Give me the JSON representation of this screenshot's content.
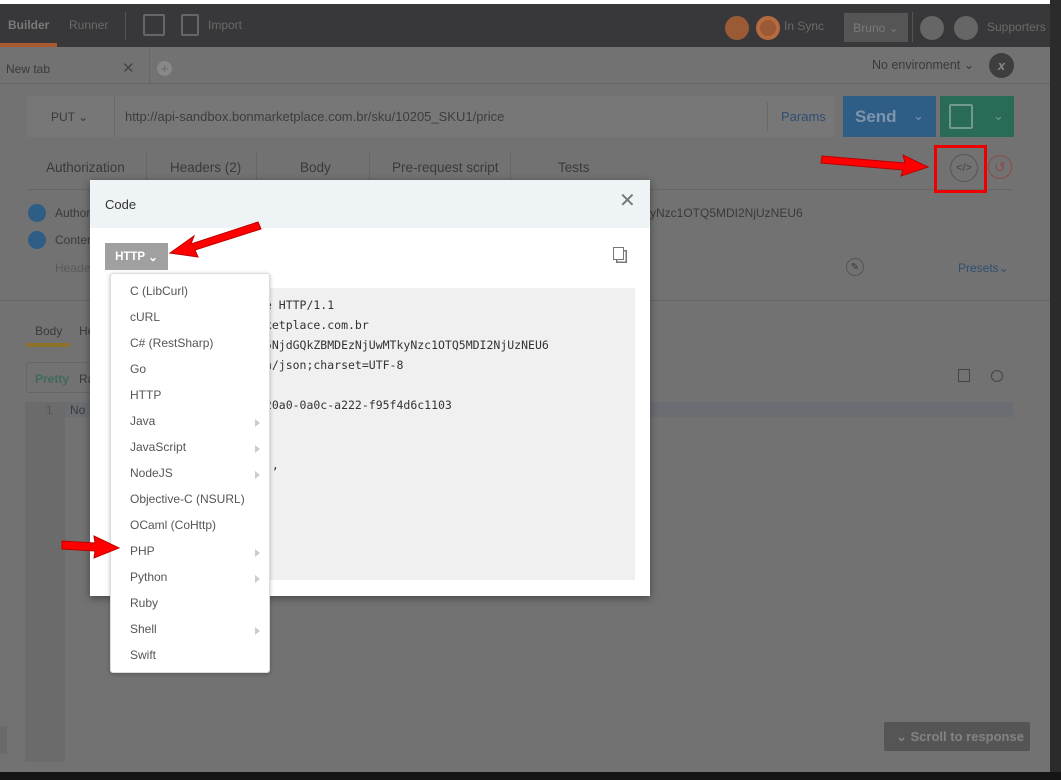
{
  "topbar": {
    "builder": "Builder",
    "runner": "Runner",
    "import": "Import",
    "sync": "In Sync",
    "user": "Bruno",
    "supporters": "Supporters"
  },
  "tabs": {
    "active": "New tab",
    "environment": "No environment"
  },
  "request": {
    "method": "PUT",
    "url": "http://api-sandbox.bonmarketplace.com.br/sku/10205_SKU1/price",
    "params": "Params",
    "send": "Send"
  },
  "request_tabs": [
    "Authorization",
    "Headers (2)",
    "Body",
    "Pre-request script",
    "Tests"
  ],
  "headers": {
    "row1_key": "Author",
    "row1_value": "yNzc1OTQ5MDI2NjUzNEU6",
    "row2_key": "Conter",
    "placeholder": "Header",
    "presets": "Presets"
  },
  "response": {
    "tab_body": "Body",
    "tab_headers": "He",
    "pretty": "Pretty",
    "raw": "Ra",
    "line_number": "1",
    "line_text": "No",
    "scroll": "Scroll to response"
  },
  "modal": {
    "title": "Code",
    "language": "HTTP",
    "code_lines": [
      "ce HTTP/1.1",
      "rketplace.com.br",
      "U5NjdGQkZBMDEzNjUwMTkyNzc1OTQ5MDI2NjUzNEU6",
      "on/json;charset=UTF-8",
      "",
      "-20a0-0a0c-a222-f95f4d6c1103",
      "",
      "",
      "0\",",
      "0\""
    ]
  },
  "languages": [
    {
      "label": "C (LibCurl)",
      "submenu": false
    },
    {
      "label": "cURL",
      "submenu": false
    },
    {
      "label": "C# (RestSharp)",
      "submenu": false
    },
    {
      "label": "Go",
      "submenu": false
    },
    {
      "label": "HTTP",
      "submenu": false
    },
    {
      "label": "Java",
      "submenu": true
    },
    {
      "label": "JavaScript",
      "submenu": true
    },
    {
      "label": "NodeJS",
      "submenu": true
    },
    {
      "label": "Objective-C (NSURL)",
      "submenu": false
    },
    {
      "label": "OCaml (CoHttp)",
      "submenu": false
    },
    {
      "label": "PHP",
      "submenu": true
    },
    {
      "label": "Python",
      "submenu": true
    },
    {
      "label": "Ruby",
      "submenu": false
    },
    {
      "label": "Shell",
      "submenu": true
    },
    {
      "label": "Swift",
      "submenu": false
    }
  ],
  "colors": {
    "send": "#2e5d86",
    "save": "#2a6b58",
    "accent": "#a8592f",
    "arrow": "#ff0000"
  }
}
